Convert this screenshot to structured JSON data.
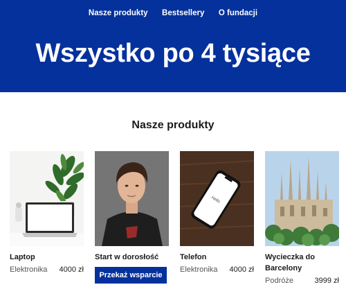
{
  "nav": {
    "items": [
      "Nasze produkty",
      "Bestsellery",
      "O fundacji"
    ]
  },
  "hero": {
    "title": "Wszystko po 4 tysiące",
    "background": "#05319c"
  },
  "section": {
    "title": "Nasze produkty"
  },
  "products": [
    {
      "name": "Laptop",
      "category": "Elektronika",
      "price": "4000 zł",
      "image_icon": "laptop-with-plant-photo"
    },
    {
      "name": "Start w dorosłość",
      "button": "Przekaż wsparcie",
      "image_icon": "teen-boy-portrait-photo"
    },
    {
      "name": "Telefon",
      "category": "Elektronika",
      "price": "4000 zł",
      "image_icon": "phone-on-wood-photo",
      "screen_text": "Hello"
    },
    {
      "name": "Wycieczka do Barcelony",
      "category": "Podróże",
      "price": "3999 zł",
      "image_icon": "sagrada-familia-photo"
    }
  ]
}
